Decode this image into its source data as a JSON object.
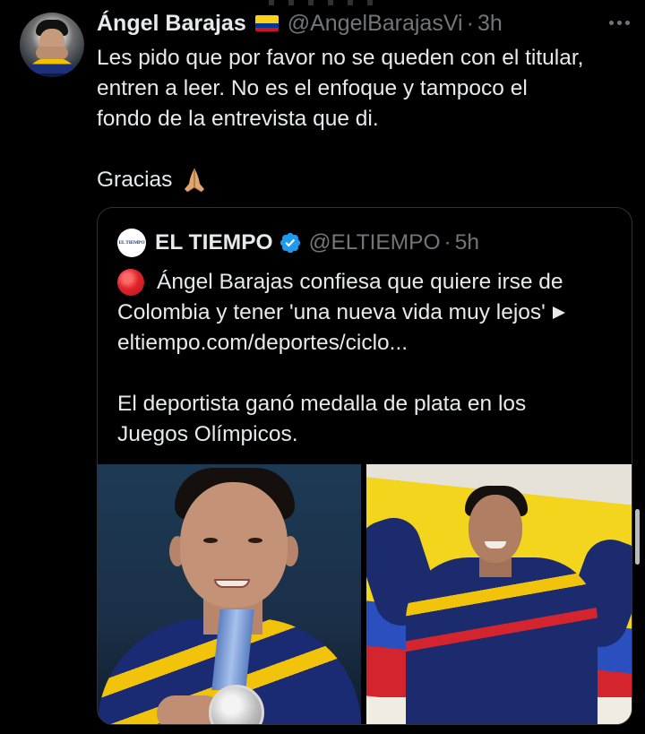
{
  "tweet": {
    "author_name": "Ángel Barajas",
    "author_flag": "colombia-flag-emoji",
    "author_handle": "@AngelBarajasVi",
    "separator": "·",
    "time": "3h",
    "body_lines": [
      "Les pido que por favor no se queden con el titular,",
      "entren a leer. No es el enfoque y tampoco el",
      "fondo de la entrevista que di."
    ],
    "closing": "Gracias",
    "closing_emoji": "folded-hands-emoji"
  },
  "quote": {
    "logo_text": "EL TIEMPO",
    "author_name": "EL TIEMPO",
    "verified": true,
    "author_handle": "@ELTIEMPO",
    "separator": "·",
    "time": "5h",
    "lines": [
      "Ángel Barajas confiesa que quiere irse de",
      "Colombia y tener 'una nueva vida muy lejos'",
      "eltiempo.com/deportes/ciclo...",
      "El deportista ganó medalla de plata en los",
      "Juegos Olímpicos."
    ],
    "media": [
      "athlete-with-silver-medal-photo",
      "athlete-with-colombian-flag-photo"
    ]
  },
  "colors": {
    "background": "#000000",
    "text_primary": "#e7e9ea",
    "text_secondary": "#71767b",
    "border": "#2f3336",
    "verified_blue": "#1d9bf0"
  }
}
